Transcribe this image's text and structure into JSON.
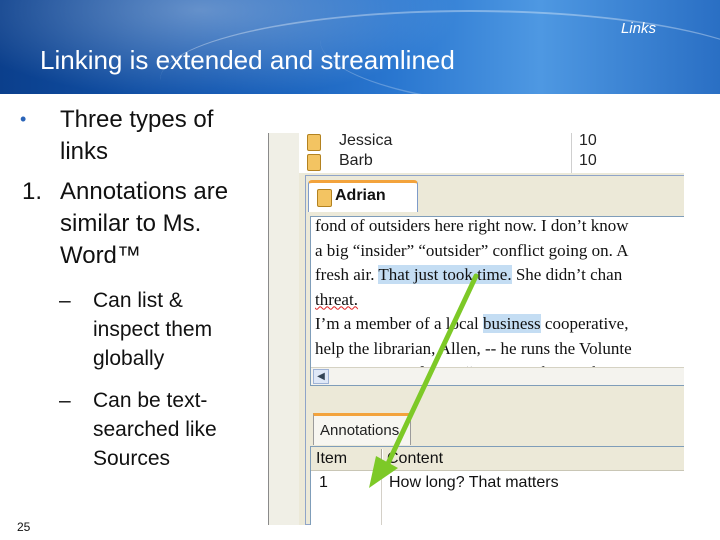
{
  "header": {
    "section_label": "Links",
    "title": "Linking is extended and streamlined"
  },
  "bullets": {
    "item1": {
      "marker": "•",
      "text": "Three types of links"
    },
    "item2": {
      "marker": "1.",
      "text": "Annotations are similar to Ms. Word™"
    },
    "sub1": {
      "marker": "–",
      "text": "Can list & inspect them globally"
    },
    "sub2": {
      "marker": "–",
      "text": "Can be text-searched like Sources"
    }
  },
  "page_number": "25",
  "screenshot": {
    "background_rows": [
      {
        "name": "Jessica",
        "value": "10"
      },
      {
        "name": "Barb",
        "value": "10"
      }
    ],
    "document_tab": "Adrian",
    "document_lines": [
      "fond of outsiders here right now.  I don’t know",
      "a big “insider” “outsider” conflict going on.  A",
      "fresh air.  That just took time.  She didn’t chan",
      "threat.",
      "I’m a member of a local business cooperative,",
      "help the librarian, Allen, -- he runs the Volunte",
      "resources out of us to “sponsor” the youth to g"
    ],
    "highlight_1": "That just took time.",
    "highlight_2": "business",
    "scroll_arrow": "◀",
    "annotations_tab": "Annotations",
    "table_headers": {
      "item": "Item",
      "content": "Content"
    },
    "table_rows": [
      {
        "item": "1",
        "content": "How long? That matters"
      }
    ]
  },
  "colors": {
    "header_dark": "#0b3f8c",
    "header_light": "#4e98e2",
    "highlight": "#c4ddf3",
    "arrow": "#7dc927",
    "tab_accent": "#f3a33c"
  }
}
